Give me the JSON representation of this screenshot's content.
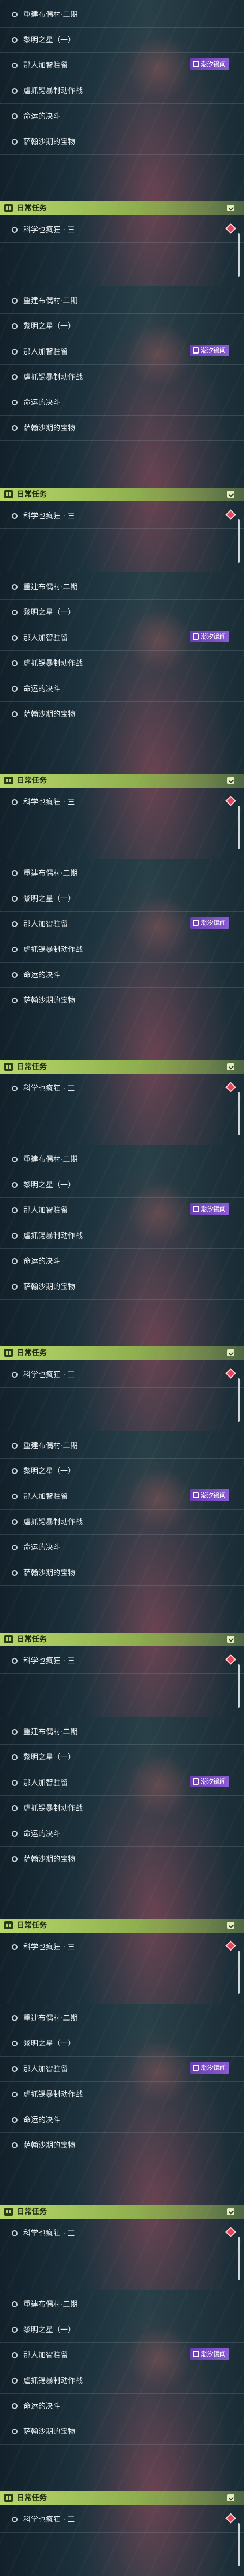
{
  "panels": [
    {
      "quests": [
        {
          "title": "重建布偶村·二期"
        },
        {
          "title": "黎明之星（一）"
        },
        {
          "title": "那人加智驻留"
        },
        {
          "title": "虐抓锡暴制动作战"
        },
        {
          "title": "命运的决斗"
        },
        {
          "title": "萨翰沙期的宝物"
        }
      ],
      "badge": {
        "label": "潮汐镜闻",
        "color": "#7a4cc4"
      },
      "daily": {
        "header": "日常任务",
        "quest": "科学也疯狂 · 三"
      }
    },
    {
      "quests": [
        {
          "title": "重建布偶村·二期"
        },
        {
          "title": "黎明之星（一）"
        },
        {
          "title": "那人加智驻留"
        },
        {
          "title": "虐抓锡暴制动作战"
        },
        {
          "title": "命运的决斗"
        },
        {
          "title": "萨翰沙期的宝物"
        }
      ],
      "badge": {
        "label": "潮汐镜闻",
        "color": "#7a4cc4"
      },
      "daily": {
        "header": "日常任务",
        "quest": "科学也疯狂 · 三"
      }
    },
    {
      "quests": [
        {
          "title": "重建布偶村·二期"
        },
        {
          "title": "黎明之星（一）"
        },
        {
          "title": "那人加智驻留"
        },
        {
          "title": "虐抓锡暴制动作战"
        },
        {
          "title": "命运的决斗"
        },
        {
          "title": "萨翰沙期的宝物"
        }
      ],
      "badge": {
        "label": "潮汐镜闻",
        "color": "#7a4cc4"
      },
      "daily": {
        "header": "日常任务",
        "quest": "科学也疯狂 · 三"
      }
    },
    {
      "quests": [
        {
          "title": "重建布偶村·二期"
        },
        {
          "title": "黎明之星（一）"
        },
        {
          "title": "那人加智驻留"
        },
        {
          "title": "虐抓锡暴制动作战"
        },
        {
          "title": "命运的决斗"
        },
        {
          "title": "萨翰沙期的宝物"
        }
      ],
      "badge": {
        "label": "潮汐镜闻",
        "color": "#7a4cc4"
      },
      "daily": {
        "header": "日常任务",
        "quest": "科学也疯狂 · 三"
      }
    },
    {
      "quests": [
        {
          "title": "重建布偶村·二期"
        },
        {
          "title": "黎明之星（一）"
        },
        {
          "title": "那人加智驻留"
        },
        {
          "title": "虐抓锡暴制动作战"
        },
        {
          "title": "命运的决斗"
        },
        {
          "title": "萨翰沙期的宝物"
        }
      ],
      "badge": {
        "label": "潮汐镜闻",
        "color": "#7a4cc4"
      },
      "daily": {
        "header": "日常任务",
        "quest": "科学也疯狂 · 三"
      }
    },
    {
      "quests": [
        {
          "title": "重建布偶村·二期"
        },
        {
          "title": "黎明之星（一）"
        },
        {
          "title": "那人加智驻留"
        },
        {
          "title": "虐抓锡暴制动作战"
        },
        {
          "title": "命运的决斗"
        },
        {
          "title": "萨翰沙期的宝物"
        }
      ],
      "badge": {
        "label": "潮汐镜闻",
        "color": "#7a4cc4"
      },
      "daily": {
        "header": "日常任务",
        "quest": "科学也疯狂 · 三"
      }
    },
    {
      "quests": [
        {
          "title": "重建布偶村·二期"
        },
        {
          "title": "黎明之星（一）"
        },
        {
          "title": "那人加智驻留"
        },
        {
          "title": "虐抓锡暴制动作战"
        },
        {
          "title": "命运的决斗"
        },
        {
          "title": "萨翰沙期的宝物"
        }
      ],
      "badge": {
        "label": "潮汐镜闻",
        "color": "#7a4cc4"
      },
      "daily": {
        "header": "日常任务",
        "quest": "科学也疯狂 · 三"
      }
    },
    {
      "quests": [
        {
          "title": "重建布偶村·二期"
        },
        {
          "title": "黎明之星（一）"
        },
        {
          "title": "那人加智驻留"
        },
        {
          "title": "虐抓锡暴制动作战"
        },
        {
          "title": "命运的决斗"
        },
        {
          "title": "萨翰沙期的宝物"
        }
      ],
      "badge": {
        "label": "潮汐镜闻",
        "color": "#7a4cc4"
      },
      "daily": {
        "header": "日常任务",
        "quest": "科学也疯狂 · 三"
      }
    },
    {
      "quests": [
        {
          "title": "重建布偶村·二期"
        },
        {
          "title": "黎明之星（一）"
        },
        {
          "title": "那人加智驻留"
        },
        {
          "title": "虐抓锡暴制动作战"
        },
        {
          "title": "命运的决斗"
        },
        {
          "title": "萨翰沙期的宝物"
        }
      ],
      "badge": {
        "label": "潮汐镜闻",
        "color": "#7a4cc4"
      },
      "daily": {
        "header": "日常任务",
        "quest": "科学也疯狂 · 三"
      }
    }
  ]
}
